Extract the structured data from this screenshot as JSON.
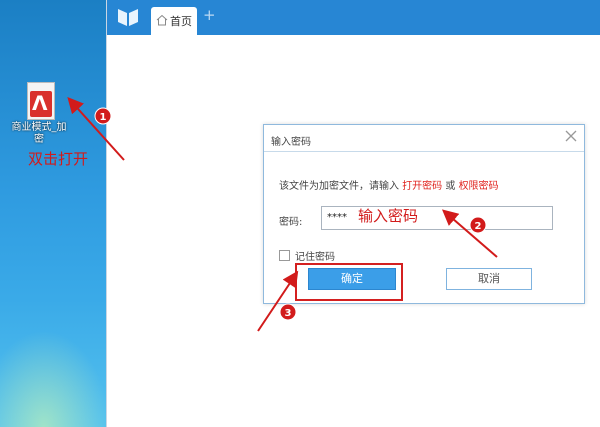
{
  "desktop": {
    "file_icon": {
      "icon": "pdf-file-icon",
      "label": "商业模式_加密"
    },
    "annotation": "双击打开"
  },
  "app": {
    "logo_icon": "book-logo-icon",
    "tabs": [
      {
        "label": "首页",
        "icon": "home-icon"
      }
    ],
    "new_tab_label": "+"
  },
  "dialog": {
    "title": "输入密码",
    "message_prefix": "该文件为加密文件，请输入",
    "message_open_pw": "打开密码",
    "message_or": "或",
    "message_perm_pw": "权限密码",
    "password_label": "密码:",
    "password_value": "****",
    "remember_label": "记住密码",
    "ok_label": "确定",
    "cancel_label": "取消"
  },
  "annotations": {
    "password_note": "输入密码",
    "steps": [
      "1",
      "2",
      "3"
    ],
    "accent_color": "#d21b1b"
  }
}
